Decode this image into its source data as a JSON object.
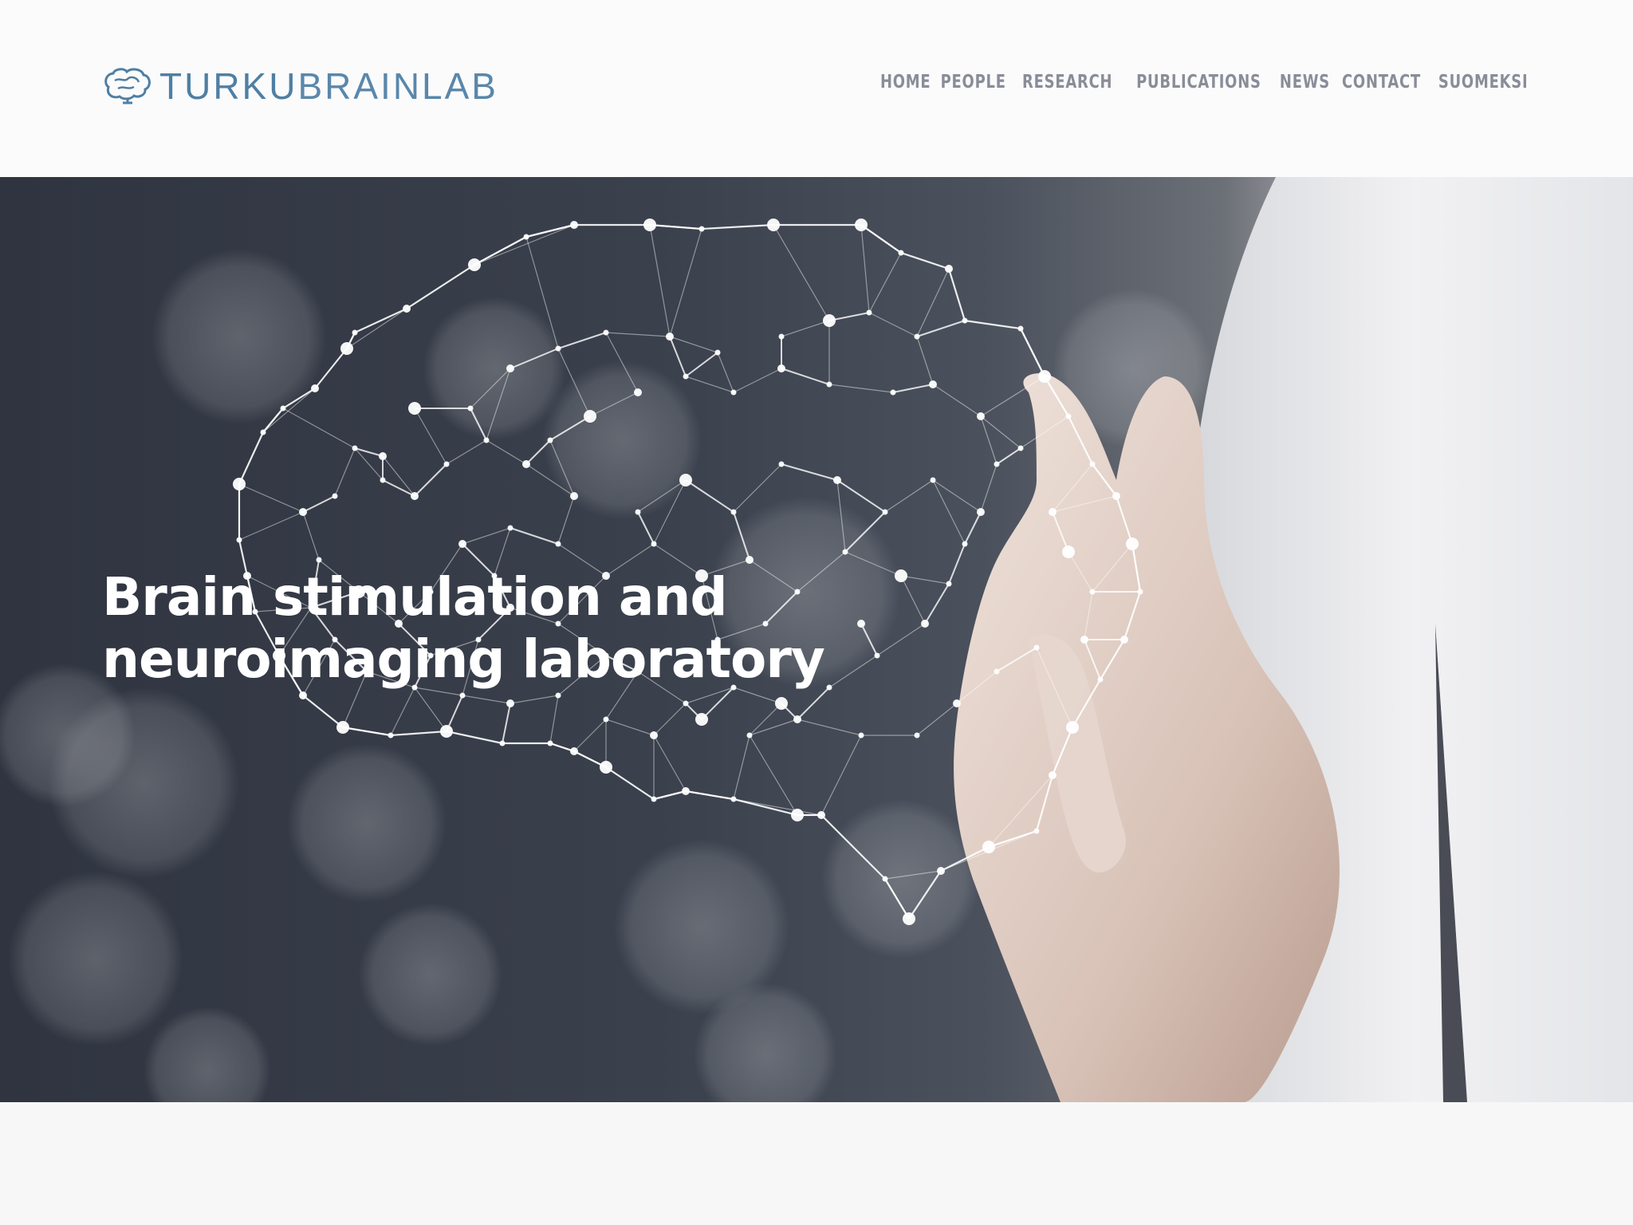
{
  "logo": {
    "text_bold": "TURKU",
    "text_light": "BRAINLAB",
    "icon": "brain-icon"
  },
  "nav": {
    "items": [
      {
        "label": "HOME"
      },
      {
        "label": "PEOPLE"
      },
      {
        "label": "RESEARCH"
      },
      {
        "label": "PUBLICATIONS"
      },
      {
        "label": "NEWS"
      },
      {
        "label": "CONTACT"
      },
      {
        "label": "SUOMEKSI"
      }
    ]
  },
  "hero": {
    "title_line1": "Brain stimulation and",
    "title_line2": "neuroimaging laboratory"
  },
  "colors": {
    "brand": "#4f7fa3",
    "nav_text": "#8a8d98",
    "hero_text": "#ffffff"
  }
}
